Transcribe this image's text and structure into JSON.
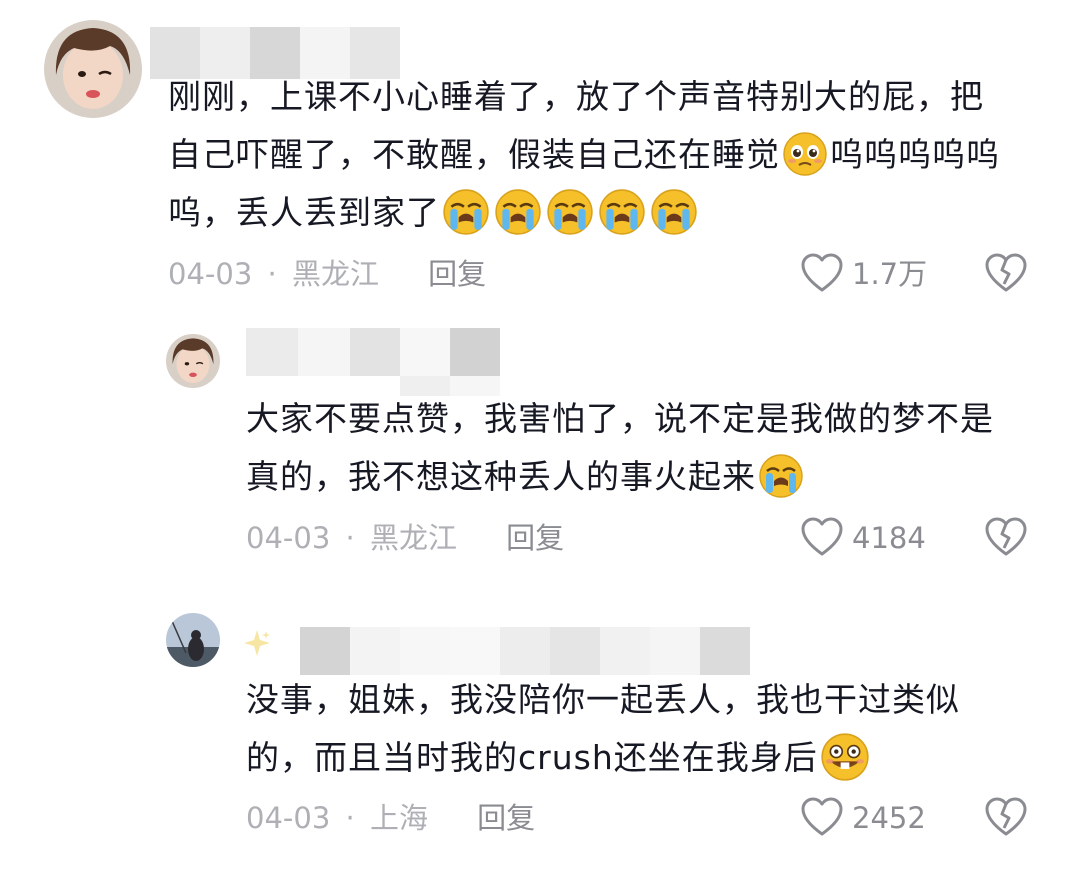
{
  "comments": [
    {
      "text": "刚刚，上课不小心睡着了，放了个声音特别大的屁，把自己吓醒了，不敢醒，假装自己还在睡觉",
      "text_suffix": "呜呜呜呜呜呜，丢人丢到家了",
      "line1": "刚刚，上课不小心睡着了，放了个声音特别大的屁，把",
      "line2": "自己吓醒了，不敢醒，假装自己还在睡觉",
      "line2b": "呜呜呜呜呜",
      "line3": "呜，丢人丢到家了",
      "date": "04-03",
      "location": "黑龙江",
      "reply_label": "回复",
      "likes": "1.7万",
      "emojis": [
        "pleading-face",
        "loudly-crying-face x5"
      ]
    },
    {
      "line1": "大家不要点赞，我害怕了，说不定是我做的梦不是",
      "line2": "真的，我不想这种丢人的事火起来",
      "date": "04-03",
      "location": "黑龙江",
      "reply_label": "回复",
      "likes": "4184",
      "emojis": [
        "loudly-crying-face"
      ]
    },
    {
      "line1": "没事，姐妹，我没陪你一起丢人，我也干过类似",
      "line2": "的，而且当时我的crush还坐在我身后",
      "date": "04-03",
      "location": "上海",
      "reply_label": "回复",
      "likes": "2452",
      "emojis": [
        "grinning-buck-tooth-face"
      ]
    }
  ],
  "separator": "·",
  "colors": {
    "text": "#161823",
    "meta": "#aeb0b5",
    "emoji": "#f5c02a"
  },
  "icons": [
    "heart-outline-icon",
    "broken-heart-icon",
    "sparkle-icon"
  ]
}
